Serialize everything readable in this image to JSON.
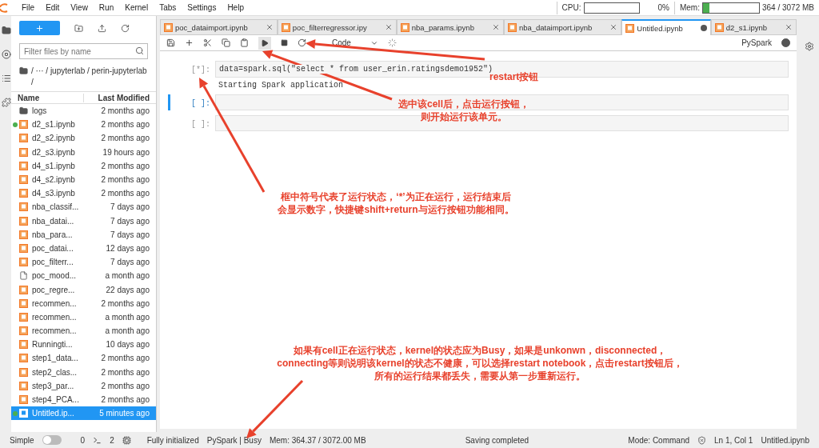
{
  "menu": [
    "File",
    "Edit",
    "View",
    "Run",
    "Kernel",
    "Tabs",
    "Settings",
    "Help"
  ],
  "resources": [
    {
      "label": "CPU:",
      "reading": "0%"
    },
    {
      "label": "Mem:",
      "level": 0.12,
      "reading": "364 / 3072 MB"
    }
  ],
  "file_browser": {
    "filter_placeholder": "Filter files by name",
    "breadcrumb": "/ ··· / jupyterlab / perin-jupyterlab /",
    "columns": [
      "Name",
      "Last Modified"
    ],
    "files": [
      {
        "name": "logs",
        "modified": "2 months ago",
        "kind": "folder",
        "running": false,
        "selected": false
      },
      {
        "name": "d2_s1.ipynb",
        "modified": "2 months ago",
        "kind": "notebook",
        "running": true,
        "selected": false
      },
      {
        "name": "d2_s2.ipynb",
        "modified": "2 months ago",
        "kind": "notebook",
        "running": false,
        "selected": false
      },
      {
        "name": "d2_s3.ipynb",
        "modified": "19 hours ago",
        "kind": "notebook",
        "running": false,
        "selected": false
      },
      {
        "name": "d4_s1.ipynb",
        "modified": "2 months ago",
        "kind": "notebook",
        "running": false,
        "selected": false
      },
      {
        "name": "d4_s2.ipynb",
        "modified": "2 months ago",
        "kind": "notebook",
        "running": false,
        "selected": false
      },
      {
        "name": "d4_s3.ipynb",
        "modified": "2 months ago",
        "kind": "notebook",
        "running": false,
        "selected": false
      },
      {
        "name": "nba_classif...",
        "modified": "7 days ago",
        "kind": "notebook",
        "running": false,
        "selected": false
      },
      {
        "name": "nba_datai...",
        "modified": "7 days ago",
        "kind": "notebook",
        "running": false,
        "selected": false
      },
      {
        "name": "nba_para...",
        "modified": "7 days ago",
        "kind": "notebook",
        "running": false,
        "selected": false
      },
      {
        "name": "poc_datai...",
        "modified": "12 days ago",
        "kind": "notebook",
        "running": false,
        "selected": false
      },
      {
        "name": "poc_filterr...",
        "modified": "7 days ago",
        "kind": "notebook",
        "running": false,
        "selected": false
      },
      {
        "name": "poc_mood...",
        "modified": "a month ago",
        "kind": "file",
        "running": false,
        "selected": false
      },
      {
        "name": "poc_regre...",
        "modified": "22 days ago",
        "kind": "notebook",
        "running": false,
        "selected": false
      },
      {
        "name": "recommen...",
        "modified": "2 months ago",
        "kind": "notebook",
        "running": false,
        "selected": false
      },
      {
        "name": "recommen...",
        "modified": "a month ago",
        "kind": "notebook",
        "running": false,
        "selected": false
      },
      {
        "name": "recommen...",
        "modified": "a month ago",
        "kind": "notebook",
        "running": false,
        "selected": false
      },
      {
        "name": "Runningti...",
        "modified": "10 days ago",
        "kind": "notebook",
        "running": false,
        "selected": false
      },
      {
        "name": "step1_data...",
        "modified": "2 months ago",
        "kind": "notebook",
        "running": false,
        "selected": false
      },
      {
        "name": "step2_clas...",
        "modified": "2 months ago",
        "kind": "notebook",
        "running": false,
        "selected": false
      },
      {
        "name": "step3_par...",
        "modified": "2 months ago",
        "kind": "notebook",
        "running": false,
        "selected": false
      },
      {
        "name": "step4_PCA...",
        "modified": "2 months ago",
        "kind": "notebook",
        "running": false,
        "selected": false
      },
      {
        "name": "Untitled.ip...",
        "modified": "5 minutes ago",
        "kind": "notebook",
        "running": true,
        "selected": true
      }
    ]
  },
  "tabs": [
    {
      "label": "poc_dataimport.ipynb",
      "selected": false,
      "dirty": false
    },
    {
      "label": "poc_filterregressor.ipy",
      "selected": false,
      "dirty": false
    },
    {
      "label": "nba_params.ipynb",
      "selected": false,
      "dirty": false
    },
    {
      "label": "nba_dataimport.ipynb",
      "selected": false,
      "dirty": false
    },
    {
      "label": "Untitled.ipynb",
      "selected": true,
      "dirty": true
    },
    {
      "label": "d2_s1.ipynb",
      "selected": false,
      "dirty": false
    }
  ],
  "notebook": {
    "cell_type": "Code",
    "kernel": "PySpark",
    "kernel_busy": true,
    "cells": [
      {
        "prompt": "[*]:",
        "code": "data=spark.sql(\"select * from user_erin.ratingsdemo1952\")",
        "output": "Starting Spark application",
        "selected": false
      },
      {
        "prompt": "[ ]:",
        "selected": true
      },
      {
        "prompt": "[ ]:",
        "selected": false
      }
    ]
  },
  "annotations": [
    {
      "lines": [
        "restart按钮"
      ]
    },
    {
      "lines": [
        "选中该cell后，点击运行按钮，",
        "则开始运行该单元。"
      ]
    },
    {
      "lines": [
        "框中符号代表了运行状态，‘*’为正在运行，运行结束后",
        "会显示数字，快捷键shift+return与运行按钮功能相同。"
      ]
    },
    {
      "lines": [
        "如果有cell正在运行状态，kernel的状态应为Busy，如果是unkonwn，disconnected，",
        "connecting等则说明该kernel的状态不健康，可以选择restart notebook，点击restart按钮后，",
        "所有的运行结果都丢失，需要从第一步重新运行。"
      ]
    }
  ],
  "status_bar": {
    "mode_label": "Simple",
    "simple_on": false,
    "terminals": "0",
    "kernels": "2",
    "init": "Fully initialized",
    "kernel_status": "PySpark | Busy",
    "memory": "Mem: 364.37 / 3072.00 MB",
    "saving": "Saving completed",
    "mode": "Mode: Command",
    "cursor": "Ln 1, Col 1",
    "file": "Untitled.ipynb"
  }
}
